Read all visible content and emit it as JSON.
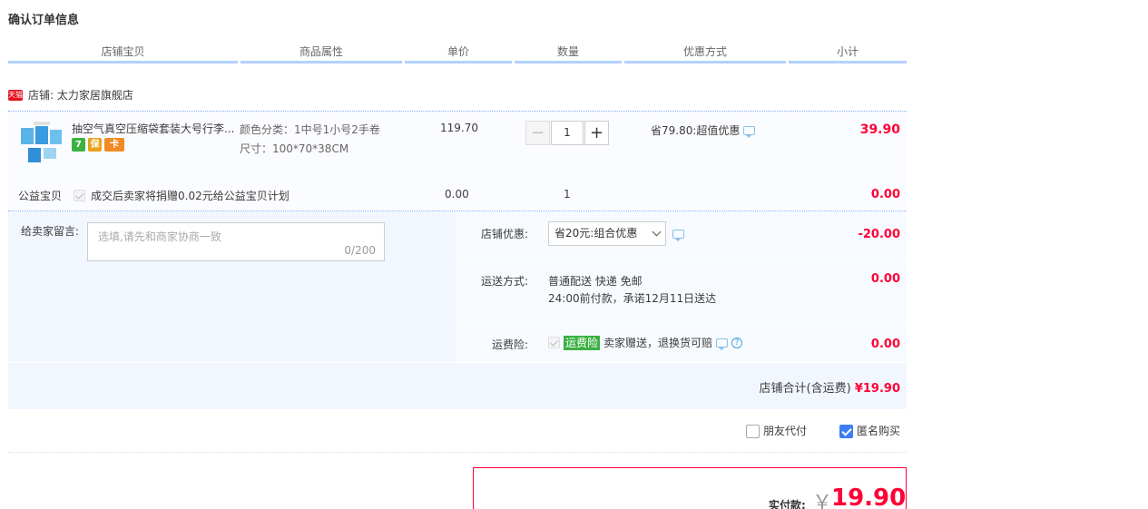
{
  "page_title": "确认订单信息",
  "columns": [
    "店铺宝贝",
    "商品属性",
    "单价",
    "数量",
    "优惠方式",
    "小计"
  ],
  "shop": {
    "badge": "天猫",
    "label": "店铺: 太力家居旗舰店"
  },
  "item": {
    "name": "抽空气真空压缩袋套装大号行李...",
    "badges": [
      "7",
      "保",
      "卡"
    ],
    "attr_color": "颜色分类：1中号1小号2手卷",
    "attr_size": "尺寸：100*70*38CM",
    "unit_price": "119.70",
    "quantity": "1",
    "minus": "−",
    "plus": "+",
    "promo": "省79.80:超值优惠",
    "subtotal": "39.90"
  },
  "charity": {
    "label": "公益宝贝",
    "text": "成交后卖家将捐赠0.02元给公益宝贝计划",
    "price": "0.00",
    "qty": "1",
    "subtotal": "0.00"
  },
  "message": {
    "label": "给卖家留言:",
    "placeholder": "选填,请先和商家协商一致",
    "count": "0/200"
  },
  "shop_discount": {
    "label": "店铺优惠:",
    "selected": "省20元:组合优惠",
    "value": "-20.00"
  },
  "shipping": {
    "label": "运送方式:",
    "line1": "普通配送 快递 免邮",
    "line2": "24:00前付款，承诺12月11日送达",
    "value": "0.00"
  },
  "insurance": {
    "label": "运费险:",
    "tag": "运费险",
    "text": "卖家赠送，退换货可赔",
    "value": "0.00"
  },
  "shop_total": {
    "label": "店铺合计(含运费)",
    "amount": "¥19.90"
  },
  "options": {
    "friend_pay": "朋友代付",
    "anonymous": "匿名购买"
  },
  "payment": {
    "label": "实付款:",
    "currency": "￥",
    "amount": "19.90"
  },
  "colors": {
    "accent_red": "#ff0036",
    "header_rule": "#b2d1ff",
    "panel_bg": "#f2f7ff",
    "checkbox_blue": "#3d7cf4",
    "insurance_green": "#3bb143"
  }
}
